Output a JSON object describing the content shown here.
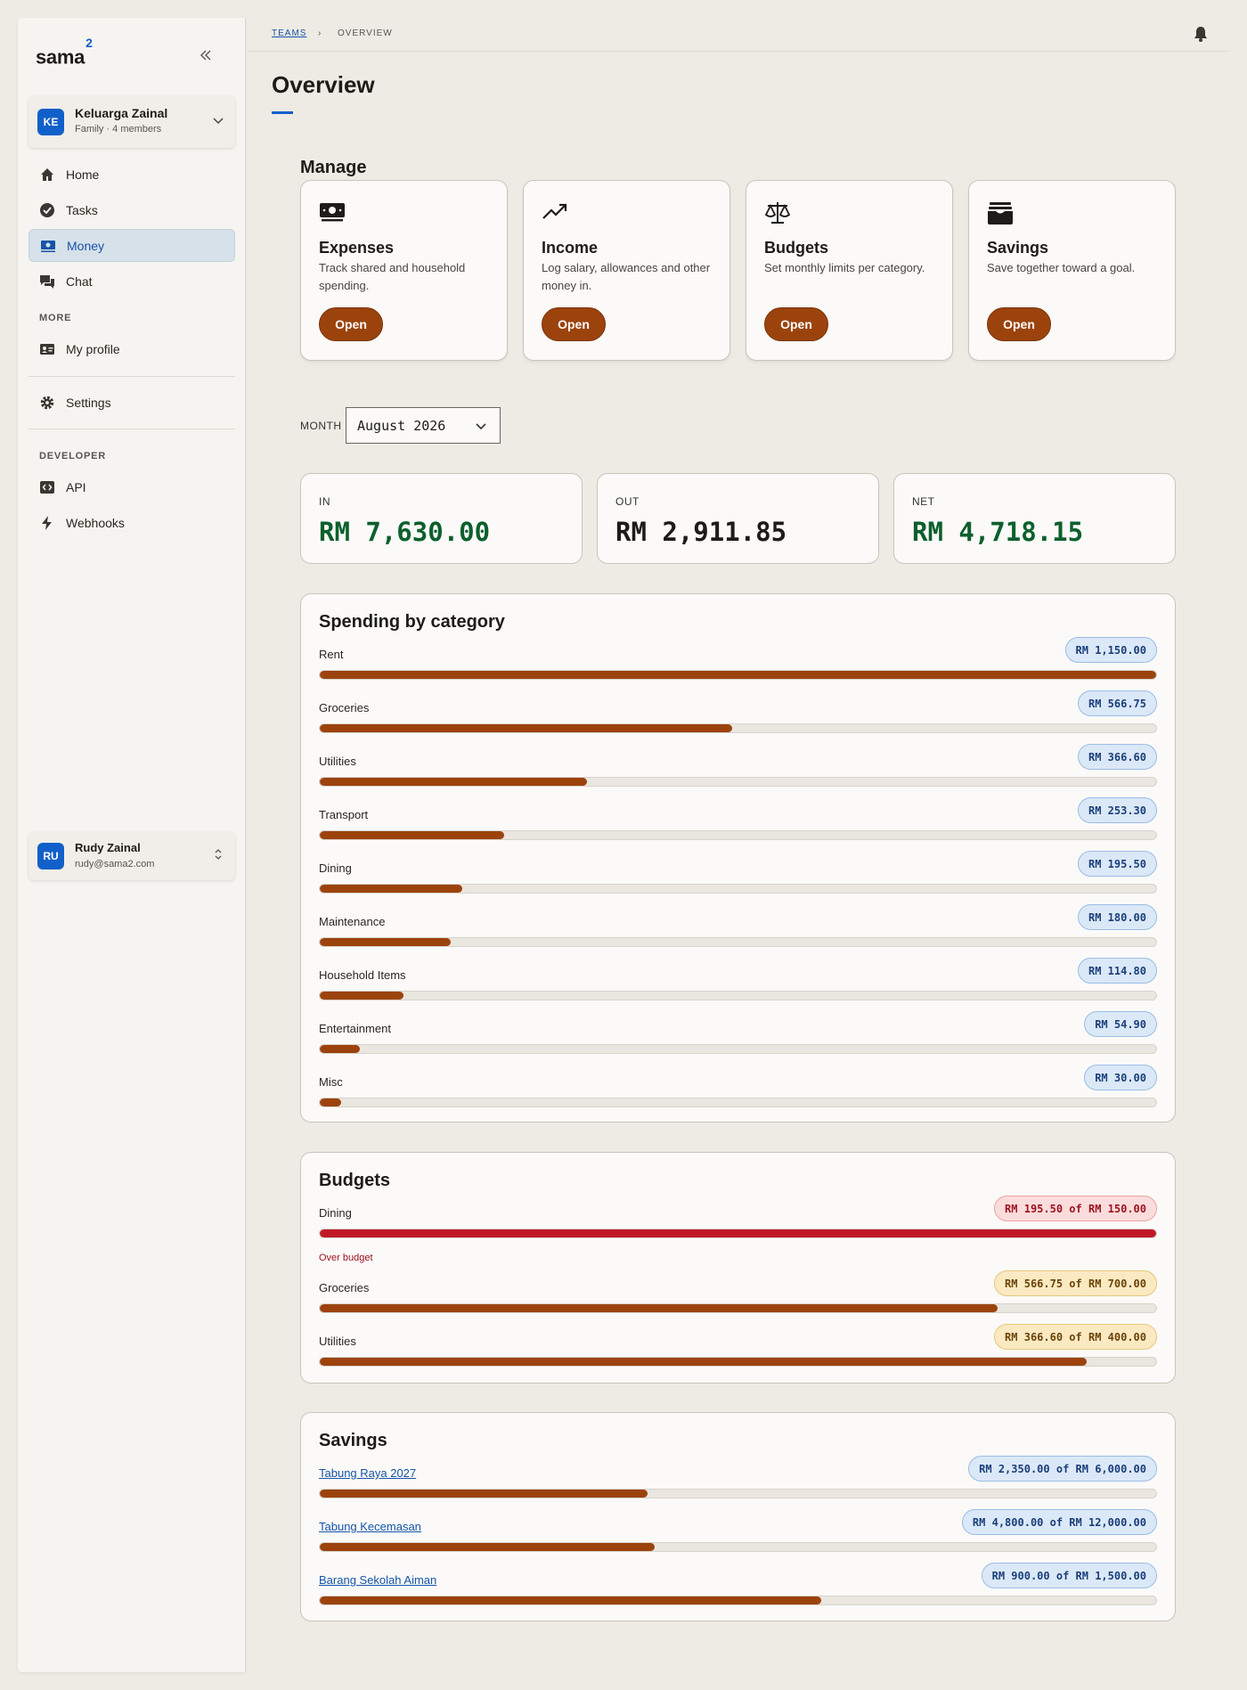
{
  "app": {
    "logo": "sama",
    "logo_sup": "2"
  },
  "team": {
    "initials": "KE",
    "name": "Keluarga Zainal",
    "subtitle": "Family · 4 members"
  },
  "nav": {
    "home": "Home",
    "tasks": "Tasks",
    "money": "Money",
    "chat": "Chat",
    "more_label": "MORE",
    "profile": "My profile",
    "settings": "Settings",
    "developer_label": "DEVELOPER",
    "api": "API",
    "webhooks": "Webhooks"
  },
  "user": {
    "initials": "RU",
    "name": "Rudy Zainal",
    "email": "rudy@sama2.com"
  },
  "breadcrumb": {
    "teams": "TEAMS",
    "separator": "›",
    "current": "OVERVIEW"
  },
  "page": {
    "title": "Overview",
    "manage_heading": "Manage"
  },
  "manage": [
    {
      "icon": "banknote-icon",
      "title": "Expenses",
      "desc": "Track shared and household spending.",
      "button": "Open"
    },
    {
      "icon": "trending-up-icon",
      "title": "Income",
      "desc": "Log salary, allowances and other money in.",
      "button": "Open"
    },
    {
      "icon": "scale-icon",
      "title": "Budgets",
      "desc": "Set monthly limits per category.",
      "button": "Open"
    },
    {
      "icon": "wallet-icon",
      "title": "Savings",
      "desc": "Save together toward a goal.",
      "button": "Open"
    }
  ],
  "month": {
    "label": "MONTH",
    "selected": "August 2026"
  },
  "stats": {
    "in_label": "IN",
    "in_value": "RM 7,630.00",
    "out_label": "OUT",
    "out_value": "RM 2,911.85",
    "net_label": "NET",
    "net_value": "RM 4,718.15"
  },
  "spending": {
    "title": "Spending by category",
    "items": [
      {
        "name": "Rent",
        "amount": "RM 1,150.00",
        "fraction": 1.0
      },
      {
        "name": "Groceries",
        "amount": "RM 566.75",
        "fraction": 0.493
      },
      {
        "name": "Utilities",
        "amount": "RM 366.60",
        "fraction": 0.319
      },
      {
        "name": "Transport",
        "amount": "RM 253.30",
        "fraction": 0.22
      },
      {
        "name": "Dining",
        "amount": "RM 195.50",
        "fraction": 0.17
      },
      {
        "name": "Maintenance",
        "amount": "RM 180.00",
        "fraction": 0.157
      },
      {
        "name": "Household Items",
        "amount": "RM 114.80",
        "fraction": 0.1
      },
      {
        "name": "Entertainment",
        "amount": "RM 54.90",
        "fraction": 0.048
      },
      {
        "name": "Misc",
        "amount": "RM 30.00",
        "fraction": 0.026
      }
    ]
  },
  "budgets": {
    "title": "Budgets",
    "over_text": "Over budget",
    "items": [
      {
        "name": "Dining",
        "amount": "RM 195.50 of RM 150.00",
        "fraction": 1.0,
        "status": "red"
      },
      {
        "name": "Groceries",
        "amount": "RM 566.75 of RM 700.00",
        "fraction": 0.81,
        "status": "amber"
      },
      {
        "name": "Utilities",
        "amount": "RM 366.60 of RM 400.00",
        "fraction": 0.917,
        "status": "amber"
      }
    ]
  },
  "savings": {
    "title": "Savings",
    "items": [
      {
        "name": "Tabung Raya 2027",
        "amount": "RM 2,350.00 of RM 6,000.00",
        "fraction": 0.392
      },
      {
        "name": "Tabung Kecemasan",
        "amount": "RM 4,800.00 of RM 12,000.00",
        "fraction": 0.4
      },
      {
        "name": "Barang Sekolah Aiman",
        "amount": "RM 900.00 of RM 1,500.00",
        "fraction": 0.6
      }
    ]
  },
  "colors": {
    "accent": "#1160c9",
    "primary_button": "#9c430d",
    "positive": "#0d5f2d",
    "over_budget": "#c01827"
  }
}
